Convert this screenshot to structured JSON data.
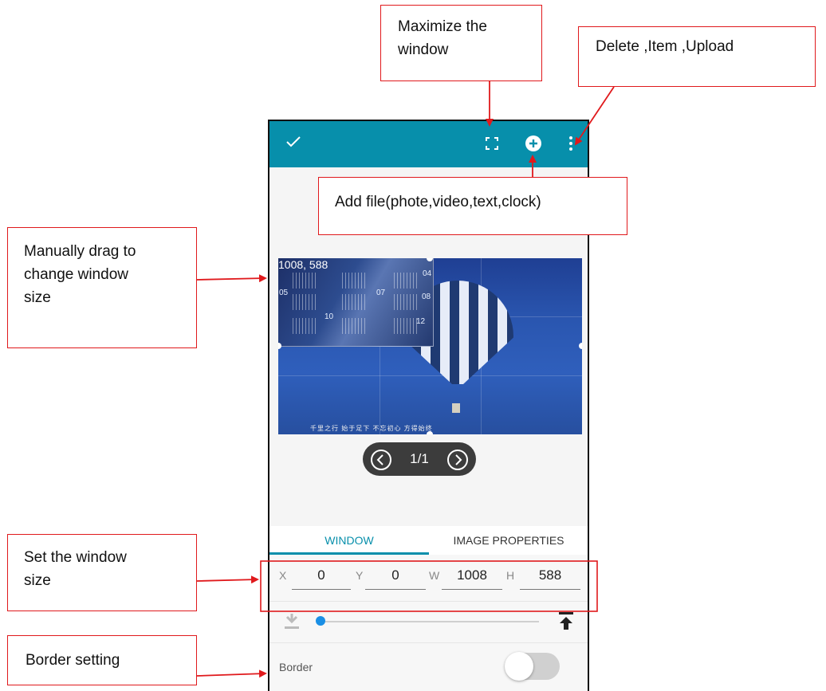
{
  "annotations": {
    "maximize": [
      "Maximize the",
      "window"
    ],
    "delete_item_upload": [
      "Delete ,Item ,Upload"
    ],
    "add_file": [
      "Add file(phote,video,text,clock)"
    ],
    "manual_drag": [
      "Manually drag to",
      "change window",
      "size"
    ],
    "set_size": [
      "Set the window",
      "size"
    ],
    "border_setting": [
      "Border setting"
    ]
  },
  "toolbar": {
    "color": "#078fab",
    "icons": [
      "check-icon",
      "maximize-icon",
      "add-icon",
      "more-icon"
    ]
  },
  "preview": {
    "size_label": "1008, 588",
    "calendar_months": [
      "04",
      "07",
      "08",
      "10",
      "12",
      "05"
    ],
    "caption": "千里之行 始于足下 不忘初心 方得始终"
  },
  "pager": {
    "page": "1/1"
  },
  "tabs": {
    "window": "WINDOW",
    "image_properties": "IMAGE PROPERTIES"
  },
  "coords": {
    "x_label": "X",
    "x_value": "0",
    "y_label": "Y",
    "y_value": "0",
    "w_label": "W",
    "w_value": "1008",
    "h_label": "H",
    "h_value": "588"
  },
  "layer_slider": {
    "value_fraction": 0.0
  },
  "border": {
    "label": "Border",
    "enabled": false
  }
}
